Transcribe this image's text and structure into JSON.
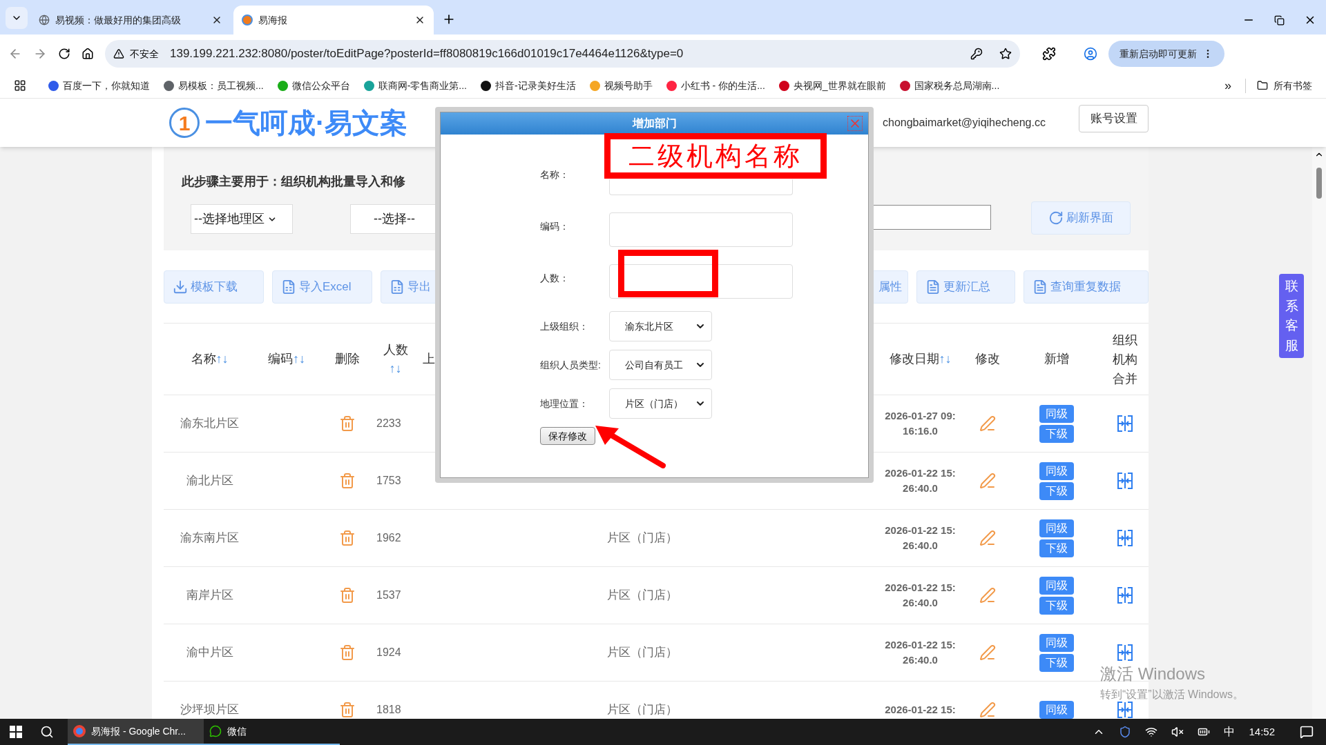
{
  "browser": {
    "tabs": [
      {
        "title": "易视频：做最好用的集团高级",
        "selected": false
      },
      {
        "title": "易海报",
        "selected": true
      }
    ],
    "address": {
      "security": "不安全",
      "url": "139.199.221.232:8080/poster/toEditPage?posterId=ff8080819c166d01019c17e4464e1126&type=0"
    },
    "update_button": "重新启动即可更新",
    "bookmarks": [
      {
        "label": "百度一下，你就知道",
        "color": "#2f5bea"
      },
      {
        "label": "易模板：员工视频...",
        "color": "#5f6368"
      },
      {
        "label": "微信公众平台",
        "color": "#1aad19"
      },
      {
        "label": "联商网-零售商业第...",
        "color": "#19a39a"
      },
      {
        "label": "抖音-记录美好生活",
        "color": "#111111"
      },
      {
        "label": "视频号助手",
        "color": "#f5a623"
      },
      {
        "label": "小红书 - 你的生活...",
        "color": "#ff2442"
      },
      {
        "label": "央视网_世界就在眼前",
        "color": "#d0021b"
      },
      {
        "label": "国家税务总局湖南...",
        "color": "#c8102e"
      }
    ],
    "more_bookmarks": "»",
    "all_bookmarks": "所有书签"
  },
  "header": {
    "logo_mark": "1",
    "logo": "一气呵成·易文案",
    "email": "chongbaimarket@yiqihecheng.cc",
    "account_button": "账号设置"
  },
  "intro": "此步骤主要用于：组织机构批量导入和修",
  "filters": {
    "region_select": "--选择地理区",
    "select": "--选择--",
    "refresh_button": "刷新界面"
  },
  "toolbar_left": [
    {
      "label": "模板下载",
      "kind": "download"
    },
    {
      "label": "导入Excel",
      "kind": "excel"
    },
    {
      "label": "导出",
      "kind": "excel"
    }
  ],
  "toolbar_right": [
    {
      "label": "属性",
      "kind": "plain"
    },
    {
      "label": "更新汇总",
      "kind": "doc"
    },
    {
      "label": "查询重复数据",
      "kind": "doc"
    }
  ],
  "table": {
    "columns": [
      {
        "label": "名称",
        "sort": "↑↓"
      },
      {
        "label": "编码",
        "sort": "↑↓"
      },
      {
        "label": "删除"
      },
      {
        "label": "人数",
        "sort": "↑↓"
      },
      {
        "label": "上"
      },
      {
        "label": "修改日期",
        "sort": "↑↓"
      },
      {
        "label": "修改"
      },
      {
        "label": "新增"
      },
      {
        "label": "组织机构合并"
      }
    ],
    "rows": [
      {
        "name": "渝东北片区",
        "count": "2233",
        "date": "2026-01-27 09:16:16.0",
        "add": [
          "同级",
          "下级"
        ]
      },
      {
        "name": "渝北片区",
        "count": "1753",
        "date": "2026-01-22 15:26:40.0",
        "add": [
          "同级",
          "下级"
        ]
      },
      {
        "name": "渝东南片区",
        "count": "1962",
        "geo": "片区（门店）",
        "date": "2026-01-22 15:26:40.0",
        "add": [
          "同级",
          "下级"
        ]
      },
      {
        "name": "南岸片区",
        "count": "1537",
        "geo": "片区（门店）",
        "date": "2026-01-22 15:26:40.0",
        "add": [
          "同级",
          "下级"
        ]
      },
      {
        "name": "渝中片区",
        "count": "1924",
        "geo": "片区（门店）",
        "date": "2026-01-22 15:26:40.0",
        "add": [
          "同级",
          "下级"
        ]
      },
      {
        "name": "沙坪坝片区",
        "count": "1818",
        "geo": "片区（门店）",
        "date": "2026-01-22 15:",
        "add": [
          "同级"
        ]
      }
    ]
  },
  "contact": "联系客服",
  "dialog": {
    "title": "增加部门",
    "fields": [
      {
        "label": "名称：",
        "kind": "text"
      },
      {
        "label": "编码：",
        "kind": "text"
      },
      {
        "label": "人数：",
        "kind": "text"
      },
      {
        "label": "上级组织：",
        "kind": "select",
        "value": "渝东北片区"
      },
      {
        "label": "组织人员类型:",
        "kind": "select",
        "value": "公司自有员工"
      },
      {
        "label": "地理位置：",
        "kind": "select",
        "value": "片区（门店）"
      }
    ],
    "save_button": "保存修改",
    "annotation": "二级机构名称"
  },
  "activation": {
    "title": "激活 Windows",
    "hint": "转到“设置”以激活 Windows。"
  },
  "taskbar": {
    "apps": [
      {
        "label": "易海报 - Google Chr...",
        "selected": true
      },
      {
        "label": "微信",
        "selected": false
      }
    ],
    "ime": "中",
    "time": "14:52"
  }
}
